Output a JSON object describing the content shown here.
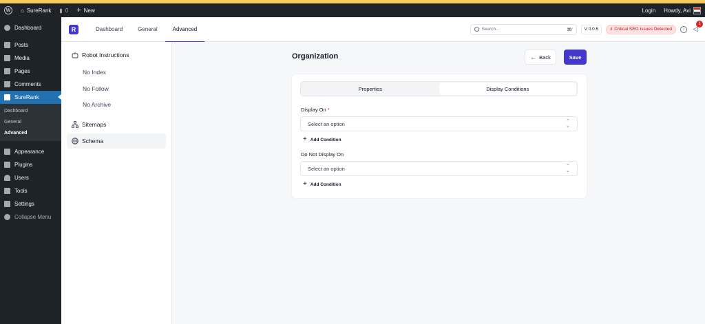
{
  "adminbar": {
    "site_name": "SureRank",
    "comments_count": "0",
    "new_label": "New",
    "login_label": "Login",
    "howdy": "Howdy, Avi"
  },
  "wp_menu": {
    "dashboard": "Dashboard",
    "posts": "Posts",
    "media": "Media",
    "pages": "Pages",
    "comments": "Comments",
    "surerank": "SureRank",
    "sub": [
      "Dashboard",
      "General",
      "Advanced"
    ],
    "appearance": "Appearance",
    "plugins": "Plugins",
    "users": "Users",
    "tools": "Tools",
    "settings": "Settings",
    "collapse": "Collapse Menu"
  },
  "app": {
    "logo_letter": "R",
    "tabs": [
      "Dashboard",
      "General",
      "Advanced"
    ],
    "search_placeholder": "Search...",
    "search_shortcut": "⌘/",
    "version": "V 0.0.5",
    "critical_label": "Critical SEO Issues Detected",
    "notification_count": "1"
  },
  "settings_nav": {
    "robot_instructions": "Robot Instructions",
    "robot_children": [
      "No Index",
      "No Follow",
      "No Archive"
    ],
    "sitemaps": "Sitemaps",
    "schema": "Schema"
  },
  "page": {
    "title": "Organization",
    "back_label": "Back",
    "save_label": "Save",
    "tabs": [
      "Properties",
      "Display Conditions"
    ],
    "display_on_label": "Display On",
    "required_mark": "*",
    "select_placeholder": "Select an option",
    "add_condition": "Add Condition",
    "do_not_display_label": "Do Not Display On"
  },
  "colors": {
    "primary": "#4338ca",
    "wp_admin_bg": "#1d2327",
    "wp_active": "#2271b1",
    "critical": "#b91c1c"
  }
}
